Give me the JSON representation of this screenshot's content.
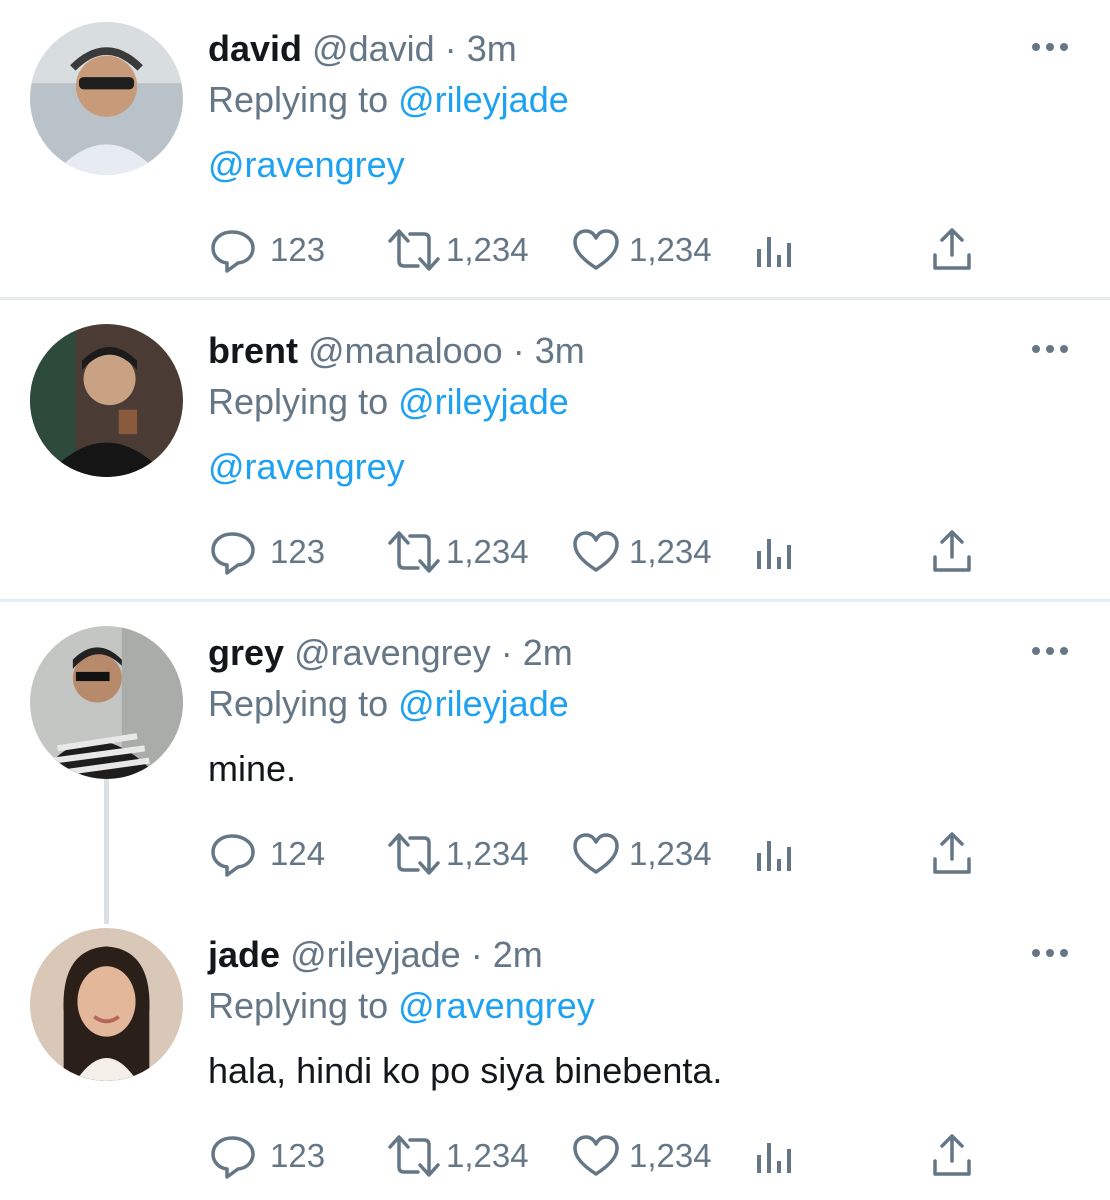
{
  "tweets": [
    {
      "name": "david",
      "handle": "@david",
      "dot": "·",
      "time": "3m",
      "replying_prefix": "Replying to",
      "replying_to": "@rileyjade",
      "body": "@ravengrey",
      "body_is_mention": true,
      "replies": "123",
      "retweets": "1,234",
      "likes": "1,234"
    },
    {
      "name": "brent",
      "handle": "@manalooo",
      "dot": "·",
      "time": "3m",
      "replying_prefix": "Replying to",
      "replying_to": "@rileyjade",
      "body": "@ravengrey",
      "body_is_mention": true,
      "replies": "123",
      "retweets": "1,234",
      "likes": "1,234"
    },
    {
      "name": "grey",
      "handle": "@ravengrey",
      "dot": "·",
      "time": "2m",
      "replying_prefix": "Replying to",
      "replying_to": "@rileyjade",
      "body": "mine.",
      "body_is_mention": false,
      "replies": "124",
      "retweets": "1,234",
      "likes": "1,234"
    },
    {
      "name": "jade",
      "handle": "@rileyjade",
      "dot": "·",
      "time": "2m",
      "replying_prefix": "Replying to",
      "replying_to": "@ravengrey",
      "body": "hala, hindi ko po siya binebenta.",
      "body_is_mention": false,
      "replies": "123",
      "retweets": "1,234",
      "likes": "1,234"
    }
  ],
  "icons": {
    "reply": "reply-icon",
    "retweet": "retweet-icon",
    "like": "heart-icon",
    "analytics": "analytics-icon",
    "share": "share-icon",
    "more": "more-icon"
  },
  "colors": {
    "link": "#1da1f2",
    "muted": "#657786",
    "text": "#14171a",
    "divider": "#e6ecf0"
  }
}
